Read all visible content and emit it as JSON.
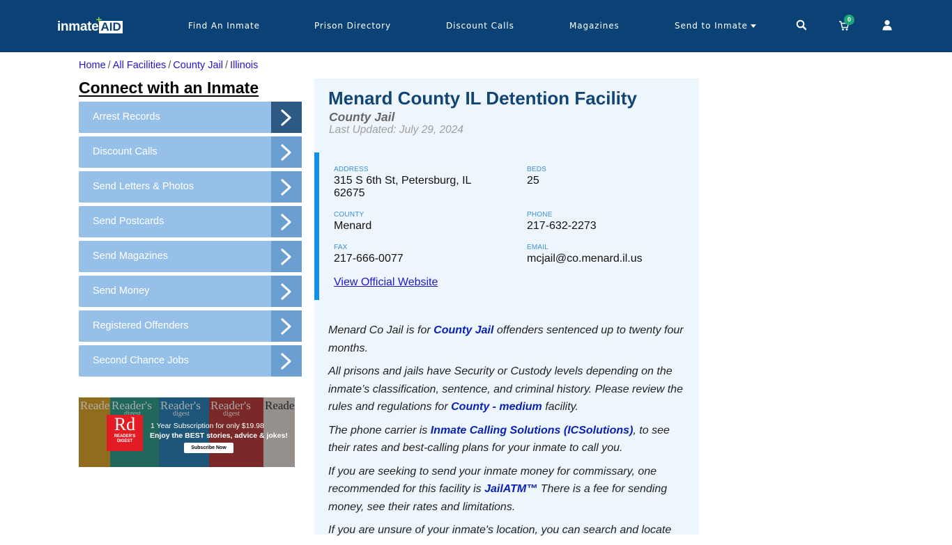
{
  "header": {
    "logo": {
      "part1": "inmate",
      "part2": "AID",
      "plus": "+"
    },
    "nav": [
      {
        "label": "Find An Inmate"
      },
      {
        "label": "Prison Directory"
      },
      {
        "label": "Discount Calls"
      },
      {
        "label": "Magazines"
      },
      {
        "label": "Send to Inmate",
        "has_dropdown": true
      }
    ],
    "icons": {
      "search": "search-icon",
      "cart": "cart-icon",
      "user": "user-icon"
    },
    "cart_count": "0",
    "colors": {
      "bar": "#0b4275",
      "badge": "#1fa67a"
    }
  },
  "breadcrumb": [
    "Home",
    "All Facilities",
    "County Jail",
    "Illinois"
  ],
  "sidebar": {
    "title": "Connect with an Inmate",
    "items": [
      {
        "label": "Arrest Records",
        "active": true
      },
      {
        "label": "Discount Calls"
      },
      {
        "label": "Send Letters & Photos"
      },
      {
        "label": "Send Postcards"
      },
      {
        "label": "Send Magazines"
      },
      {
        "label": "Send Money"
      },
      {
        "label": "Registered Offenders"
      },
      {
        "label": "Second Chance Jobs"
      }
    ],
    "ad": {
      "brand_short": "Rd",
      "brand_name": "READER'S DIGEST",
      "cover_title": "Reader's",
      "cover_sub": "digest",
      "line1": "1 Year Subscription for only $19.98",
      "line2": "Enjoy the BEST stories, advice & jokes!",
      "button": "Subscribe Now"
    }
  },
  "facility": {
    "name": "Menard County IL Detention Facility",
    "type": "County Jail",
    "last_updated": "Last Updated: July 29, 2024",
    "fields": {
      "address": {
        "label": "Address",
        "value": "315 S 6th St, Petersburg, IL 62675"
      },
      "beds": {
        "label": "Beds",
        "value": "25"
      },
      "county": {
        "label": "County",
        "value": "Menard"
      },
      "phone": {
        "label": "Phone",
        "value": "217-632-2273"
      },
      "fax": {
        "label": "Fax",
        "value": "217-666-0077"
      },
      "email": {
        "label": "Email",
        "value": "mcjail@co.menard.il.us"
      }
    },
    "website_link": "View Official Website",
    "description": {
      "p1": {
        "before": "Menard Co Jail is for ",
        "link": "County Jail",
        "after": " offenders sentenced up to twenty four months."
      },
      "p2": {
        "before": "All prisons and jails have Security or Custody levels depending on the inmate’s classification, sentence, and criminal history. Please review the rules and regulations for ",
        "link": "County - medium",
        "after": " facility."
      },
      "p3": {
        "before": "The phone carrier is ",
        "link": "Inmate Calling Solutions (ICSolutions)",
        "after": ", to see their rates and best-calling plans for your inmate to call you."
      },
      "p4": {
        "before": "If you are seeking to send your inmate money for commissary, one recommended for this facility is ",
        "link": "JailATM™",
        "after": " There is a fee for sending money, see their rates and limitations."
      },
      "p5": {
        "before": "If you are unsure of your inmate's location, you can search and locate"
      }
    }
  }
}
